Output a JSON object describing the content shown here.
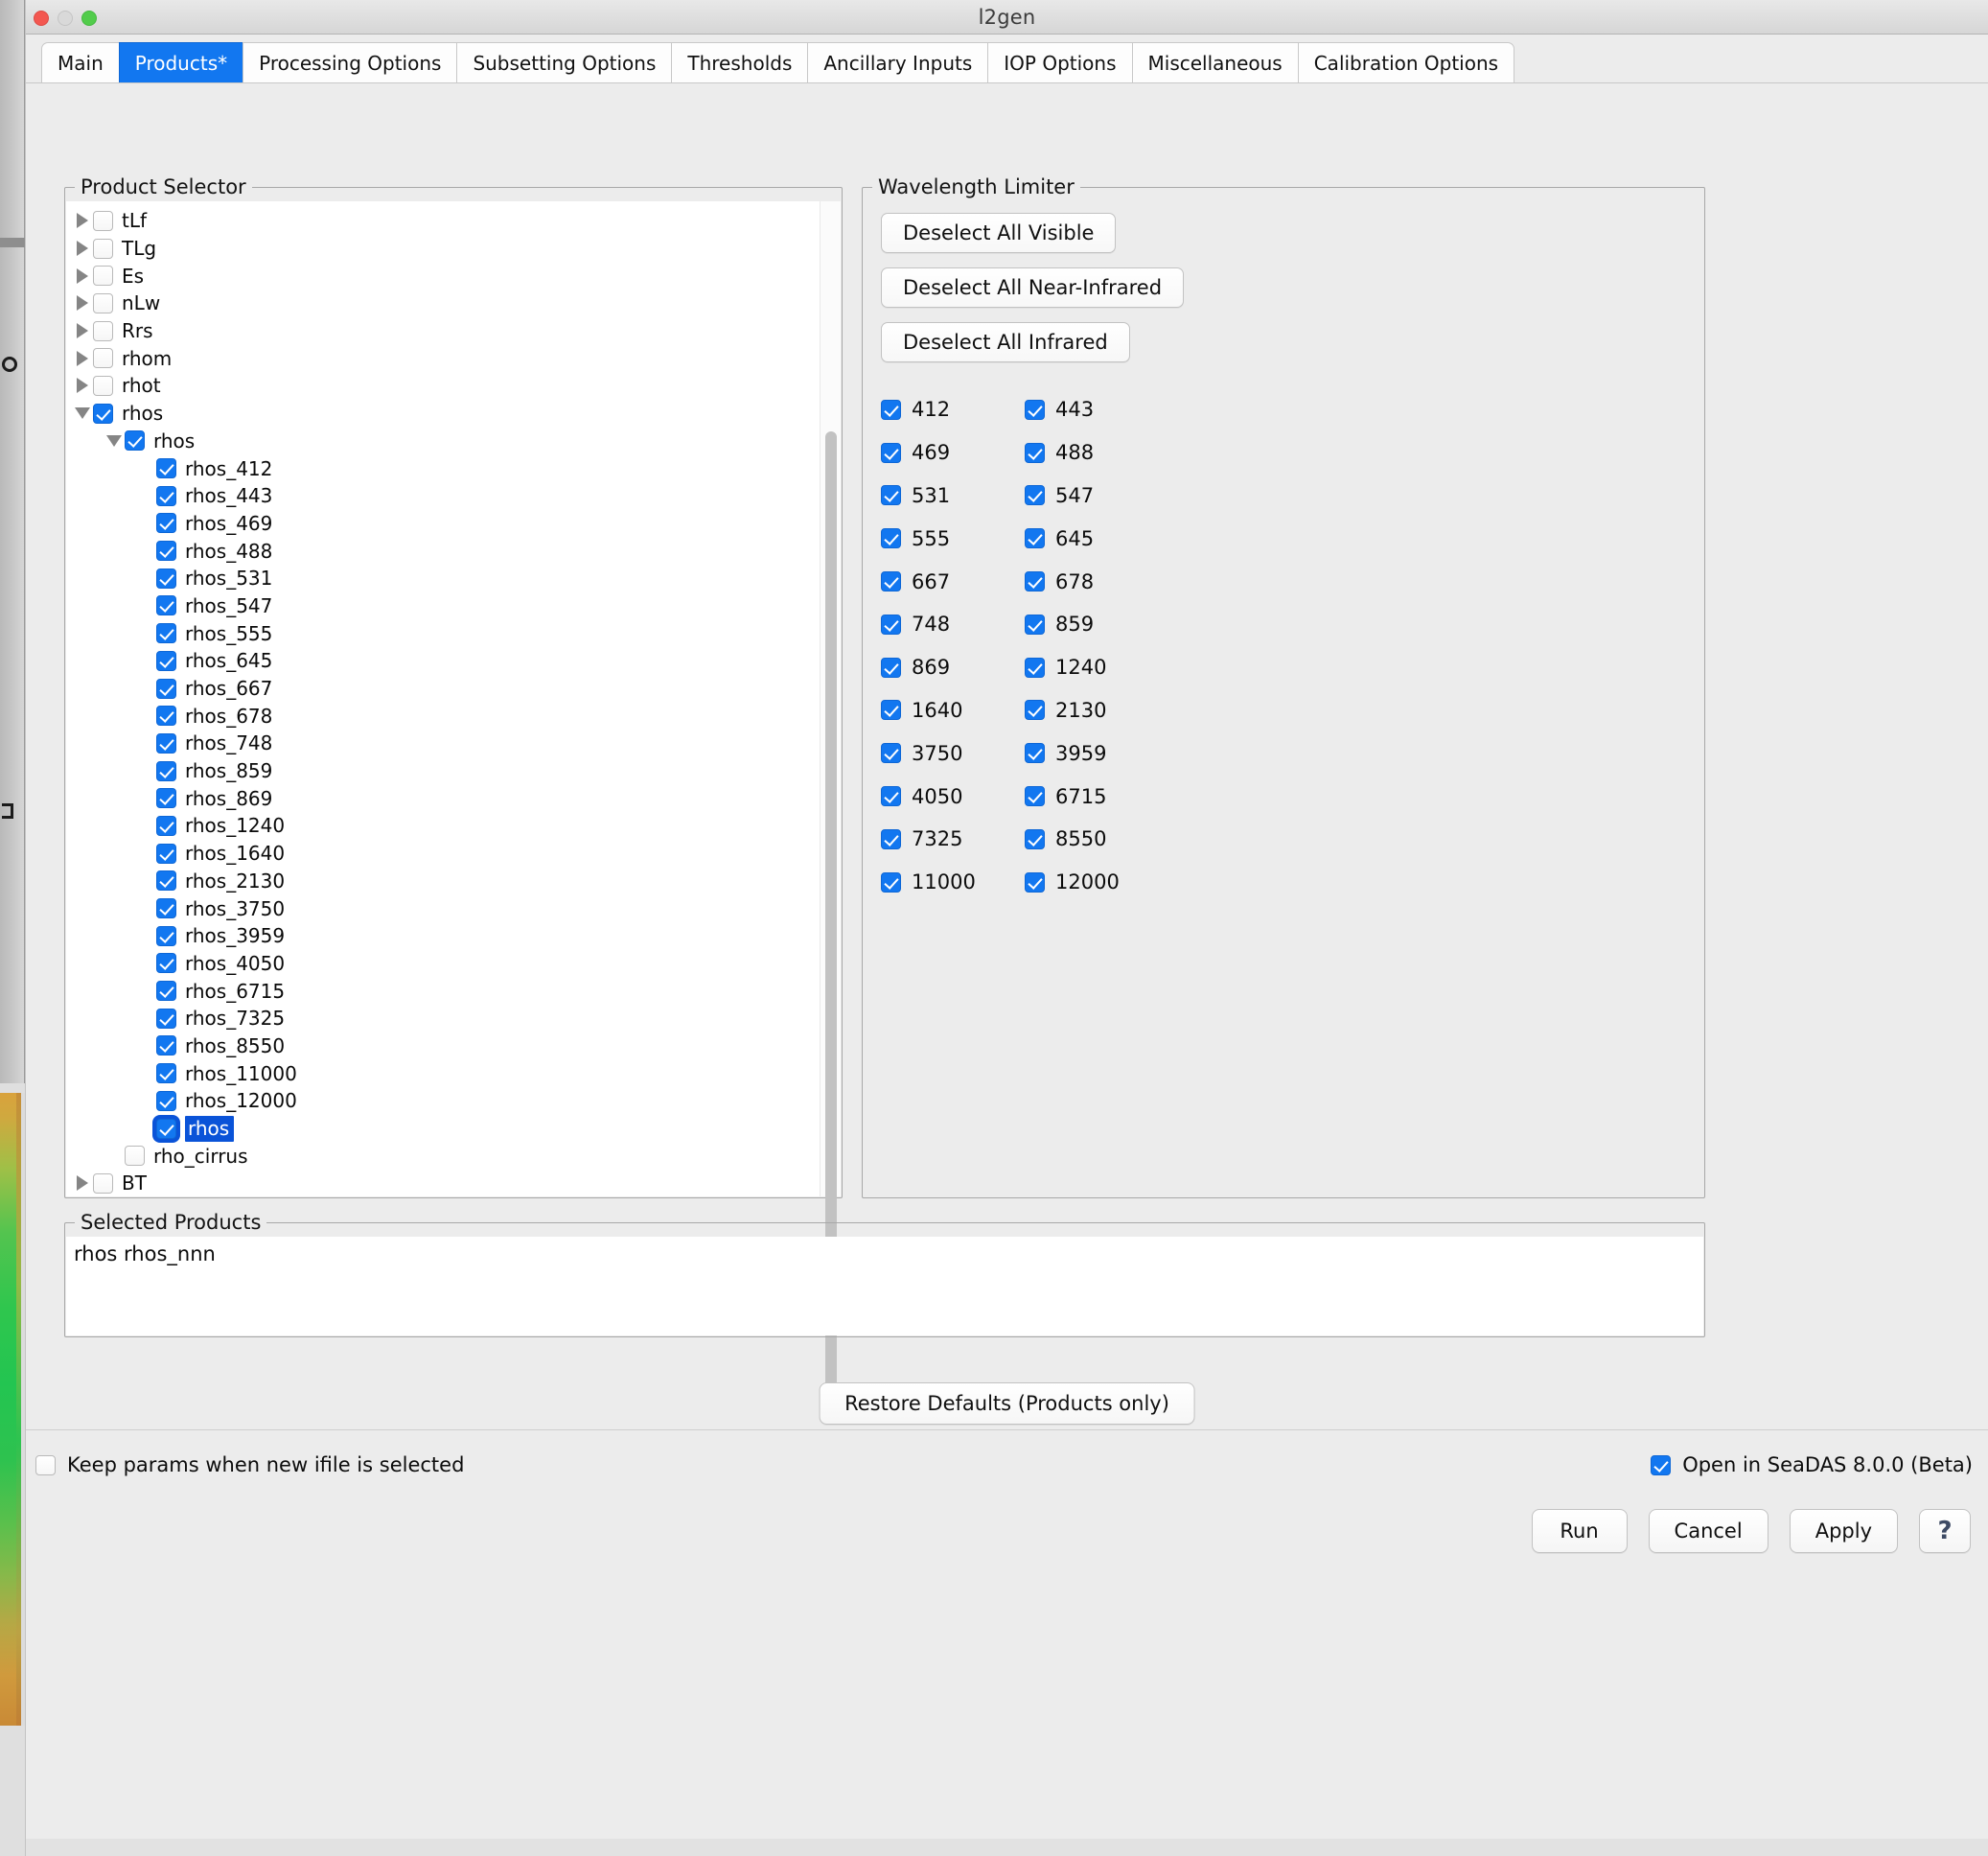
{
  "window": {
    "title": "l2gen",
    "traffic_lights": [
      "close",
      "minimize",
      "zoom"
    ]
  },
  "tabs": [
    {
      "label": "Main",
      "active": false
    },
    {
      "label": "Products*",
      "active": true
    },
    {
      "label": "Processing Options",
      "active": false
    },
    {
      "label": "Subsetting Options",
      "active": false
    },
    {
      "label": "Thresholds",
      "active": false
    },
    {
      "label": "Ancillary Inputs",
      "active": false
    },
    {
      "label": "IOP Options",
      "active": false
    },
    {
      "label": "Miscellaneous",
      "active": false
    },
    {
      "label": "Calibration Options",
      "active": false
    }
  ],
  "product_selector": {
    "legend": "Product Selector",
    "rows": [
      {
        "label": "tLf",
        "indent": 0,
        "twisty": "right",
        "checked": false,
        "selected": false
      },
      {
        "label": "TLg",
        "indent": 0,
        "twisty": "right",
        "checked": false,
        "selected": false
      },
      {
        "label": "Es",
        "indent": 0,
        "twisty": "right",
        "checked": false,
        "selected": false
      },
      {
        "label": "nLw",
        "indent": 0,
        "twisty": "right",
        "checked": false,
        "selected": false
      },
      {
        "label": "Rrs",
        "indent": 0,
        "twisty": "right",
        "checked": false,
        "selected": false
      },
      {
        "label": "rhom",
        "indent": 0,
        "twisty": "right",
        "checked": false,
        "selected": false
      },
      {
        "label": "rhot",
        "indent": 0,
        "twisty": "right",
        "checked": false,
        "selected": false
      },
      {
        "label": "rhos",
        "indent": 0,
        "twisty": "down",
        "checked": true,
        "selected": false
      },
      {
        "label": "rhos",
        "indent": 1,
        "twisty": "down",
        "checked": true,
        "selected": false
      },
      {
        "label": "rhos_412",
        "indent": 2,
        "twisty": "none",
        "checked": true,
        "selected": false
      },
      {
        "label": "rhos_443",
        "indent": 2,
        "twisty": "none",
        "checked": true,
        "selected": false
      },
      {
        "label": "rhos_469",
        "indent": 2,
        "twisty": "none",
        "checked": true,
        "selected": false
      },
      {
        "label": "rhos_488",
        "indent": 2,
        "twisty": "none",
        "checked": true,
        "selected": false
      },
      {
        "label": "rhos_531",
        "indent": 2,
        "twisty": "none",
        "checked": true,
        "selected": false
      },
      {
        "label": "rhos_547",
        "indent": 2,
        "twisty": "none",
        "checked": true,
        "selected": false
      },
      {
        "label": "rhos_555",
        "indent": 2,
        "twisty": "none",
        "checked": true,
        "selected": false
      },
      {
        "label": "rhos_645",
        "indent": 2,
        "twisty": "none",
        "checked": true,
        "selected": false
      },
      {
        "label": "rhos_667",
        "indent": 2,
        "twisty": "none",
        "checked": true,
        "selected": false
      },
      {
        "label": "rhos_678",
        "indent": 2,
        "twisty": "none",
        "checked": true,
        "selected": false
      },
      {
        "label": "rhos_748",
        "indent": 2,
        "twisty": "none",
        "checked": true,
        "selected": false
      },
      {
        "label": "rhos_859",
        "indent": 2,
        "twisty": "none",
        "checked": true,
        "selected": false
      },
      {
        "label": "rhos_869",
        "indent": 2,
        "twisty": "none",
        "checked": true,
        "selected": false
      },
      {
        "label": "rhos_1240",
        "indent": 2,
        "twisty": "none",
        "checked": true,
        "selected": false
      },
      {
        "label": "rhos_1640",
        "indent": 2,
        "twisty": "none",
        "checked": true,
        "selected": false
      },
      {
        "label": "rhos_2130",
        "indent": 2,
        "twisty": "none",
        "checked": true,
        "selected": false
      },
      {
        "label": "rhos_3750",
        "indent": 2,
        "twisty": "none",
        "checked": true,
        "selected": false
      },
      {
        "label": "rhos_3959",
        "indent": 2,
        "twisty": "none",
        "checked": true,
        "selected": false
      },
      {
        "label": "rhos_4050",
        "indent": 2,
        "twisty": "none",
        "checked": true,
        "selected": false
      },
      {
        "label": "rhos_6715",
        "indent": 2,
        "twisty": "none",
        "checked": true,
        "selected": false
      },
      {
        "label": "rhos_7325",
        "indent": 2,
        "twisty": "none",
        "checked": true,
        "selected": false
      },
      {
        "label": "rhos_8550",
        "indent": 2,
        "twisty": "none",
        "checked": true,
        "selected": false
      },
      {
        "label": "rhos_11000",
        "indent": 2,
        "twisty": "none",
        "checked": true,
        "selected": false
      },
      {
        "label": "rhos_12000",
        "indent": 2,
        "twisty": "none",
        "checked": true,
        "selected": false
      },
      {
        "label": "rhos",
        "indent": 2,
        "twisty": "none",
        "checked": true,
        "selected": true
      },
      {
        "label": "rho_cirrus",
        "indent": 1,
        "twisty": "none",
        "checked": false,
        "selected": false
      },
      {
        "label": "BT",
        "indent": 0,
        "twisty": "right",
        "checked": false,
        "selected": false
      }
    ]
  },
  "wavelength_limiter": {
    "legend": "Wavelength Limiter",
    "buttons": [
      {
        "label": "Deselect All Visible"
      },
      {
        "label": "Deselect All Near-Infrared"
      },
      {
        "label": "Deselect All Infrared"
      }
    ],
    "wavelengths": [
      {
        "label": "412",
        "checked": true
      },
      {
        "label": "443",
        "checked": true
      },
      {
        "label": "469",
        "checked": true
      },
      {
        "label": "488",
        "checked": true
      },
      {
        "label": "531",
        "checked": true
      },
      {
        "label": "547",
        "checked": true
      },
      {
        "label": "555",
        "checked": true
      },
      {
        "label": "645",
        "checked": true
      },
      {
        "label": "667",
        "checked": true
      },
      {
        "label": "678",
        "checked": true
      },
      {
        "label": "748",
        "checked": true
      },
      {
        "label": "859",
        "checked": true
      },
      {
        "label": "869",
        "checked": true
      },
      {
        "label": "1240",
        "checked": true
      },
      {
        "label": "1640",
        "checked": true
      },
      {
        "label": "2130",
        "checked": true
      },
      {
        "label": "3750",
        "checked": true
      },
      {
        "label": "3959",
        "checked": true
      },
      {
        "label": "4050",
        "checked": true
      },
      {
        "label": "6715",
        "checked": true
      },
      {
        "label": "7325",
        "checked": true
      },
      {
        "label": "8550",
        "checked": true
      },
      {
        "label": "11000",
        "checked": true
      },
      {
        "label": "12000",
        "checked": true
      }
    ]
  },
  "selected_products": {
    "legend": "Selected Products",
    "value": "rhos rhos_nnn"
  },
  "restore_defaults": {
    "label": "Restore Defaults (Products only)"
  },
  "footer": {
    "keep_params": {
      "label": "Keep params when new ifile is selected",
      "checked": false
    },
    "open_seadas": {
      "label": "Open in SeaDAS 8.0.0 (Beta)",
      "checked": true
    },
    "buttons": [
      {
        "label": "Run",
        "name": "run-button"
      },
      {
        "label": "Cancel",
        "name": "cancel-button"
      },
      {
        "label": "Apply",
        "name": "apply-button"
      },
      {
        "label": "?",
        "name": "help-button"
      }
    ]
  },
  "colors": {
    "accent_blue": "#1277f0",
    "selection_blue": "#0a53d8",
    "window_bg": "#ececec",
    "panel_white": "#ffffff"
  }
}
